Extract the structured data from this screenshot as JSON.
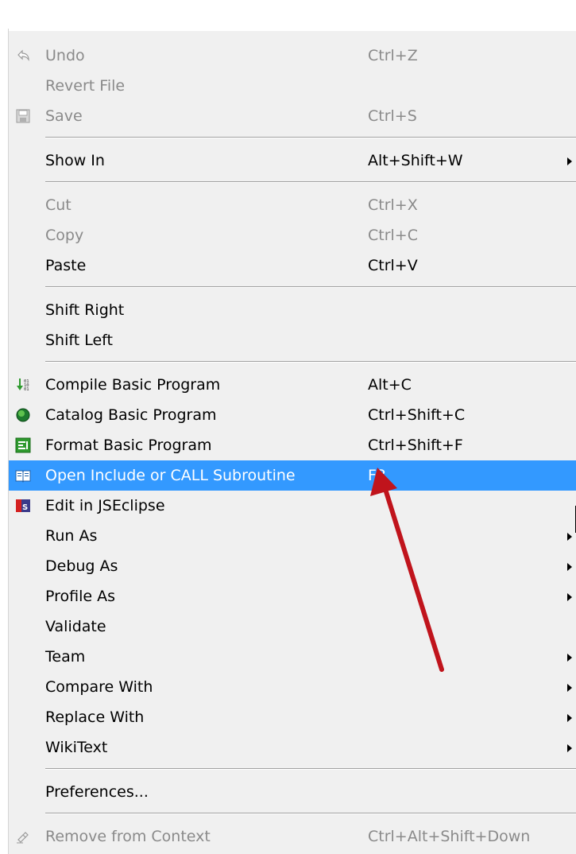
{
  "menu": {
    "items": [
      {
        "label": "Undo",
        "shortcut": "Ctrl+Z",
        "disabled": true,
        "icon": "undo-icon"
      },
      {
        "label": "Revert File",
        "shortcut": "",
        "disabled": true
      },
      {
        "label": "Save",
        "shortcut": "Ctrl+S",
        "disabled": true,
        "icon": "save-icon"
      },
      {
        "label": "Show In",
        "shortcut": "Alt+Shift+W",
        "submenu": true
      },
      {
        "label": "Cut",
        "shortcut": "Ctrl+X",
        "disabled": true
      },
      {
        "label": "Copy",
        "shortcut": "Ctrl+C",
        "disabled": true
      },
      {
        "label": "Paste",
        "shortcut": "Ctrl+V"
      },
      {
        "label": "Shift Right",
        "shortcut": ""
      },
      {
        "label": "Shift Left",
        "shortcut": ""
      },
      {
        "label": "Compile Basic Program",
        "shortcut": "Alt+C",
        "icon": "compile-binary-icon"
      },
      {
        "label": "Catalog Basic Program",
        "shortcut": "Ctrl+Shift+C",
        "icon": "catalog-globe-icon"
      },
      {
        "label": "Format Basic Program",
        "shortcut": "Ctrl+Shift+F",
        "icon": "format-document-icon"
      },
      {
        "label": "Open Include or CALL Subroutine",
        "shortcut": "F3",
        "icon": "open-book-icon",
        "highlighted": true
      },
      {
        "label": "Edit in JSEclipse",
        "shortcut": "",
        "icon": "jseclipse-icon"
      },
      {
        "label": "Run As",
        "shortcut": "",
        "submenu": true
      },
      {
        "label": "Debug As",
        "shortcut": "",
        "submenu": true
      },
      {
        "label": "Profile As",
        "shortcut": "",
        "submenu": true
      },
      {
        "label": "Validate",
        "shortcut": ""
      },
      {
        "label": "Team",
        "shortcut": "",
        "submenu": true
      },
      {
        "label": "Compare With",
        "shortcut": "",
        "submenu": true
      },
      {
        "label": "Replace With",
        "shortcut": "",
        "submenu": true
      },
      {
        "label": "WikiText",
        "shortcut": "",
        "submenu": true
      },
      {
        "label": "Preferences...",
        "shortcut": ""
      },
      {
        "label": "Remove from Context",
        "shortcut": "Ctrl+Alt+Shift+Down",
        "disabled": true,
        "icon": "remove-context-icon"
      }
    ]
  },
  "colors": {
    "highlight": "#3399ff",
    "annotation_arrow": "#c0141c",
    "menu_bg": "#f0f0f0"
  }
}
